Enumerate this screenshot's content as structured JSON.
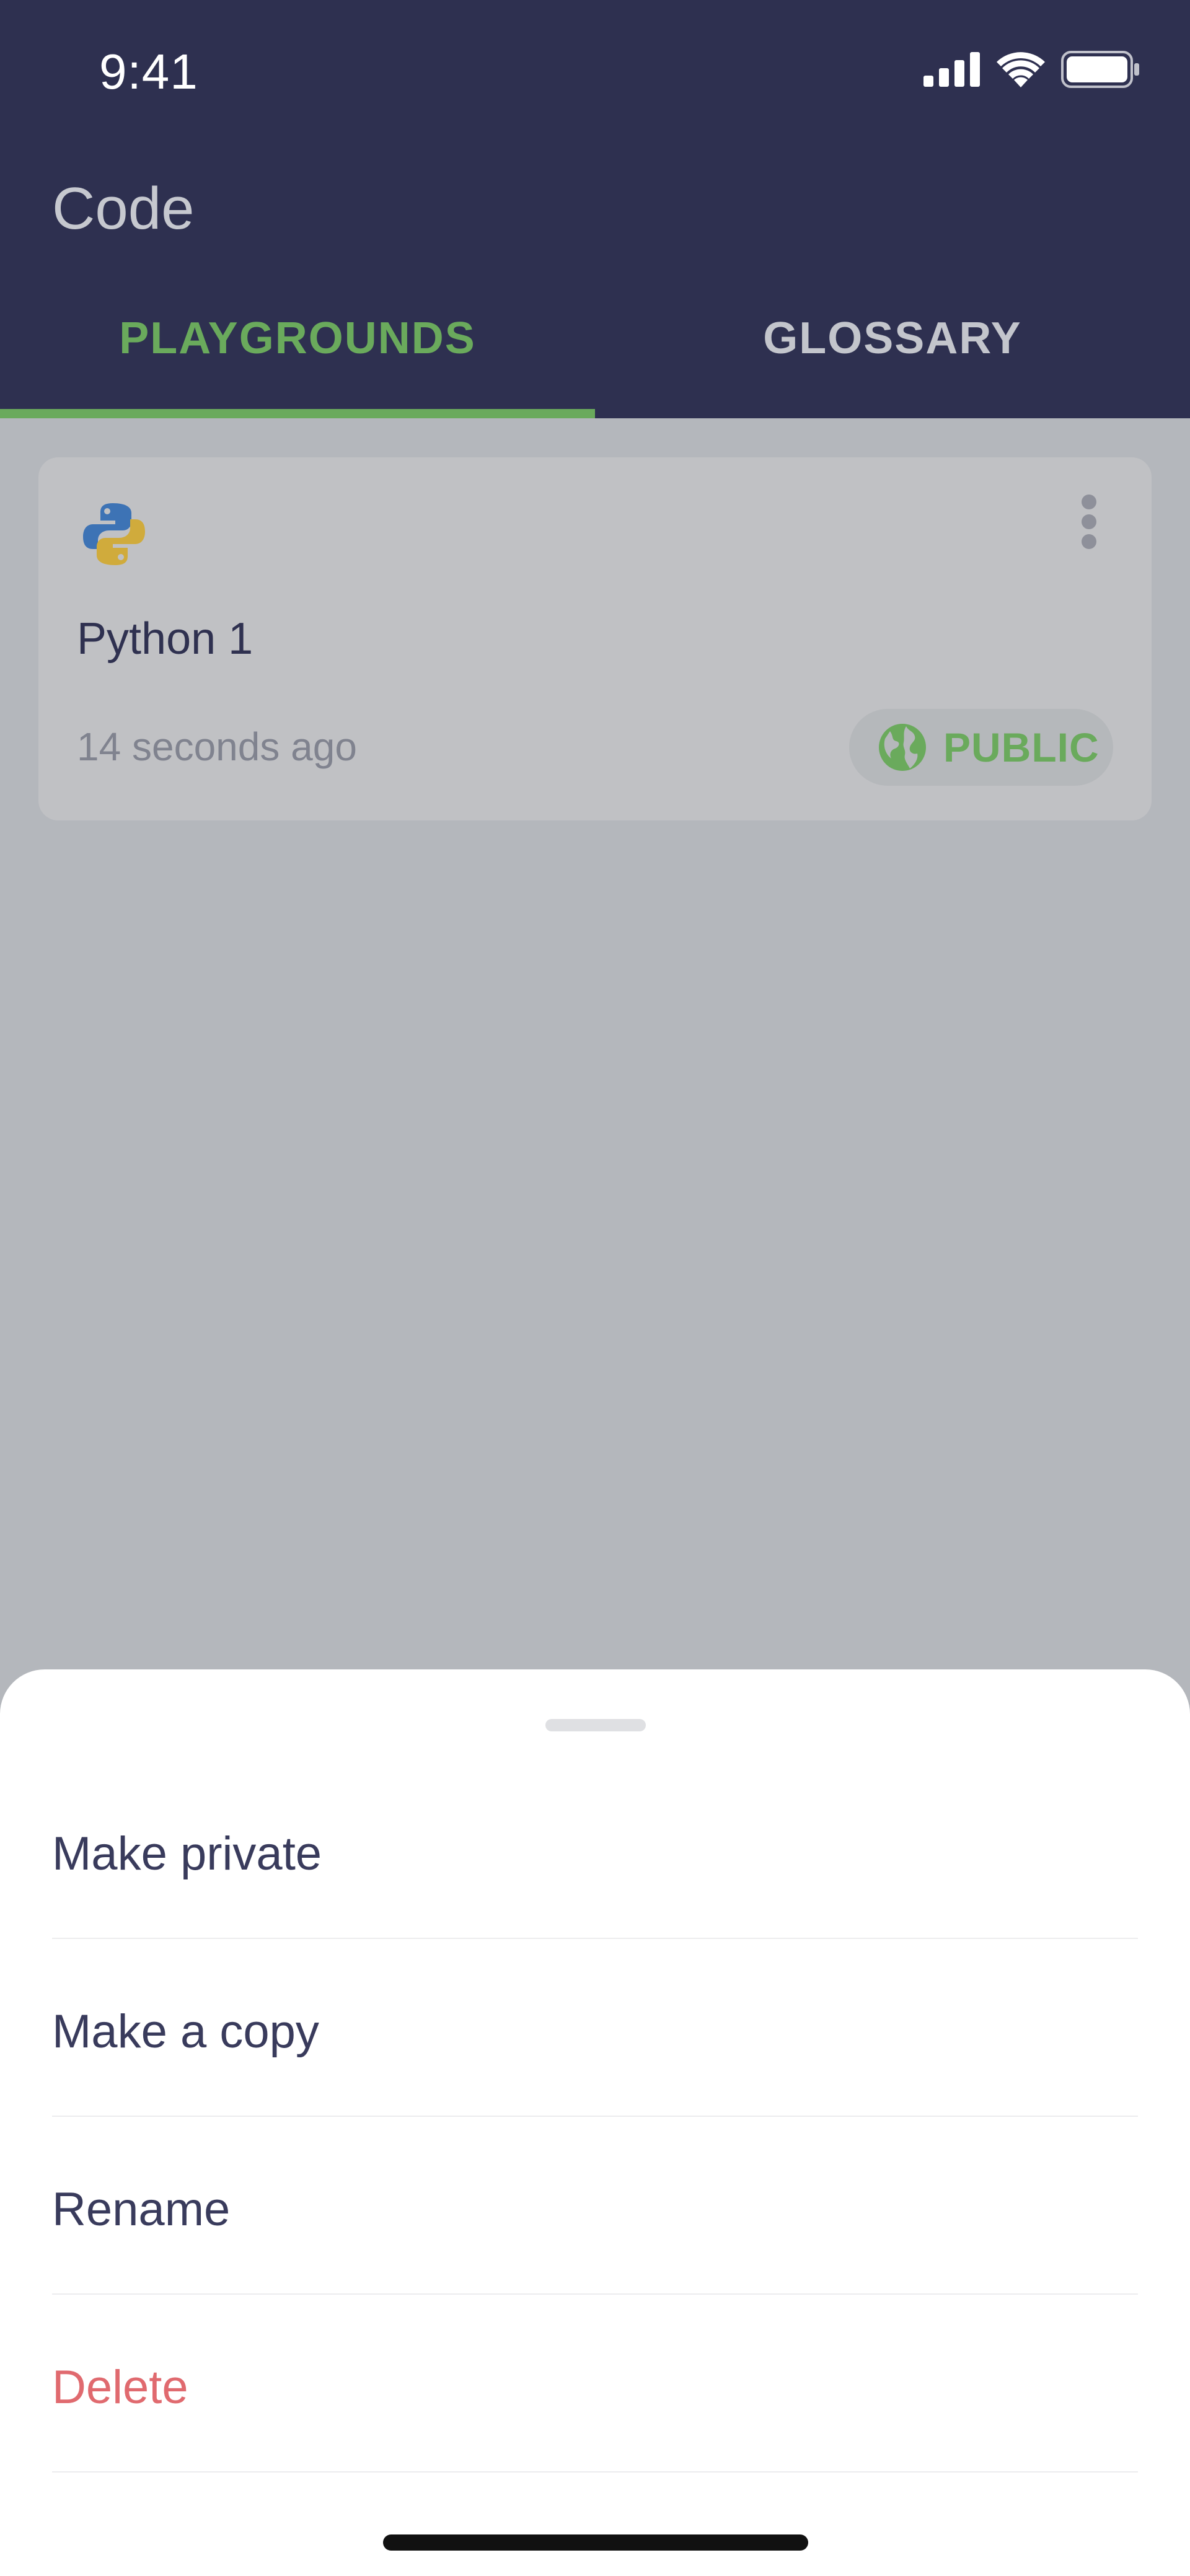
{
  "status_bar": {
    "time": "9:41"
  },
  "header": {
    "title": "Code"
  },
  "tabs": [
    {
      "label": "PLAYGROUNDS",
      "active": true
    },
    {
      "label": "GLOSSARY",
      "active": false
    }
  ],
  "card": {
    "icon": "python-icon",
    "title": "Python 1",
    "timestamp": "14 seconds ago",
    "badge": "PUBLIC",
    "badge_icon": "globe-icon"
  },
  "sheet": {
    "items": [
      {
        "label": "Make private"
      },
      {
        "label": "Make a copy"
      },
      {
        "label": "Rename"
      },
      {
        "label": "Delete",
        "destructive": true
      }
    ]
  },
  "colors": {
    "header_bg": "#2e3050",
    "accent_green": "#6aaa5c",
    "danger_red": "#e06a6f",
    "overlay_bg": "#b4b7bc"
  }
}
